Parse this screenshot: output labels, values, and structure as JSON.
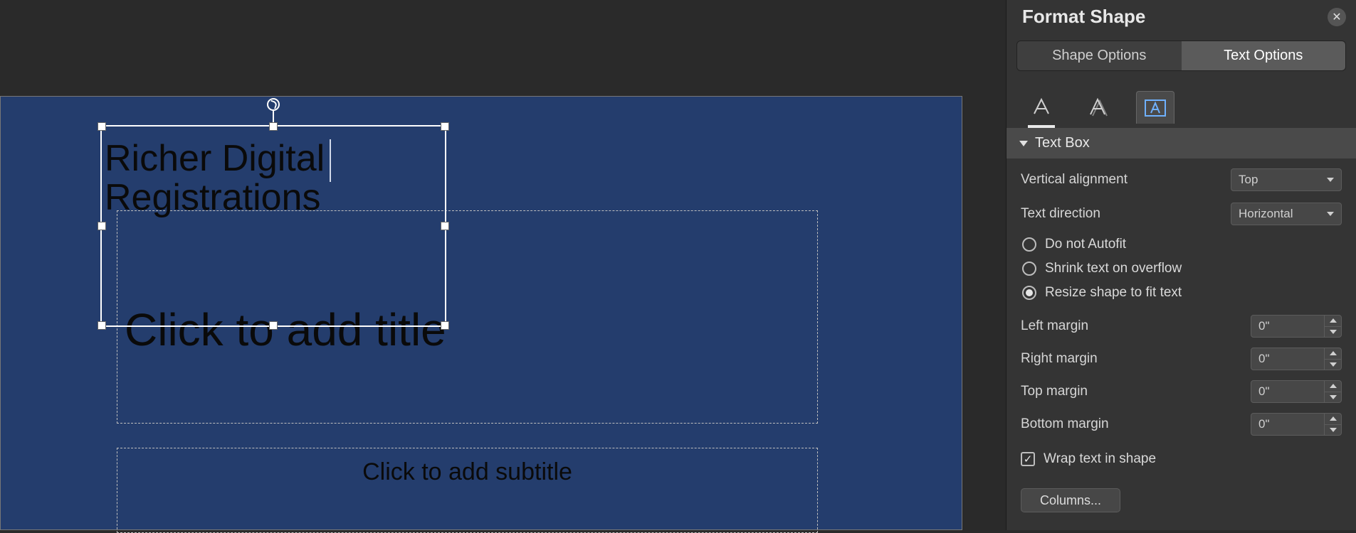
{
  "slide": {
    "textbox_content": "Richer Digital\nRegistrations",
    "title_placeholder": "Click to add title",
    "subtitle_placeholder": "Click to add subtitle"
  },
  "panel": {
    "title": "Format Shape",
    "tabs": {
      "shape": "Shape Options",
      "text": "Text Options"
    },
    "section": {
      "textbox": "Text Box"
    },
    "vertical_alignment": {
      "label": "Vertical alignment",
      "value": "Top"
    },
    "text_direction": {
      "label": "Text direction",
      "value": "Horizontal"
    },
    "autofit": {
      "none": "Do not Autofit",
      "shrink": "Shrink text on overflow",
      "resize": "Resize shape to fit text",
      "selected": "resize"
    },
    "margins": {
      "left": {
        "label": "Left margin",
        "value": "0\""
      },
      "right": {
        "label": "Right margin",
        "value": "0\""
      },
      "top": {
        "label": "Top margin",
        "value": "0\""
      },
      "bottom": {
        "label": "Bottom margin",
        "value": "0\""
      }
    },
    "wrap": {
      "label": "Wrap text in shape",
      "checked": true
    },
    "columns_button": "Columns..."
  }
}
